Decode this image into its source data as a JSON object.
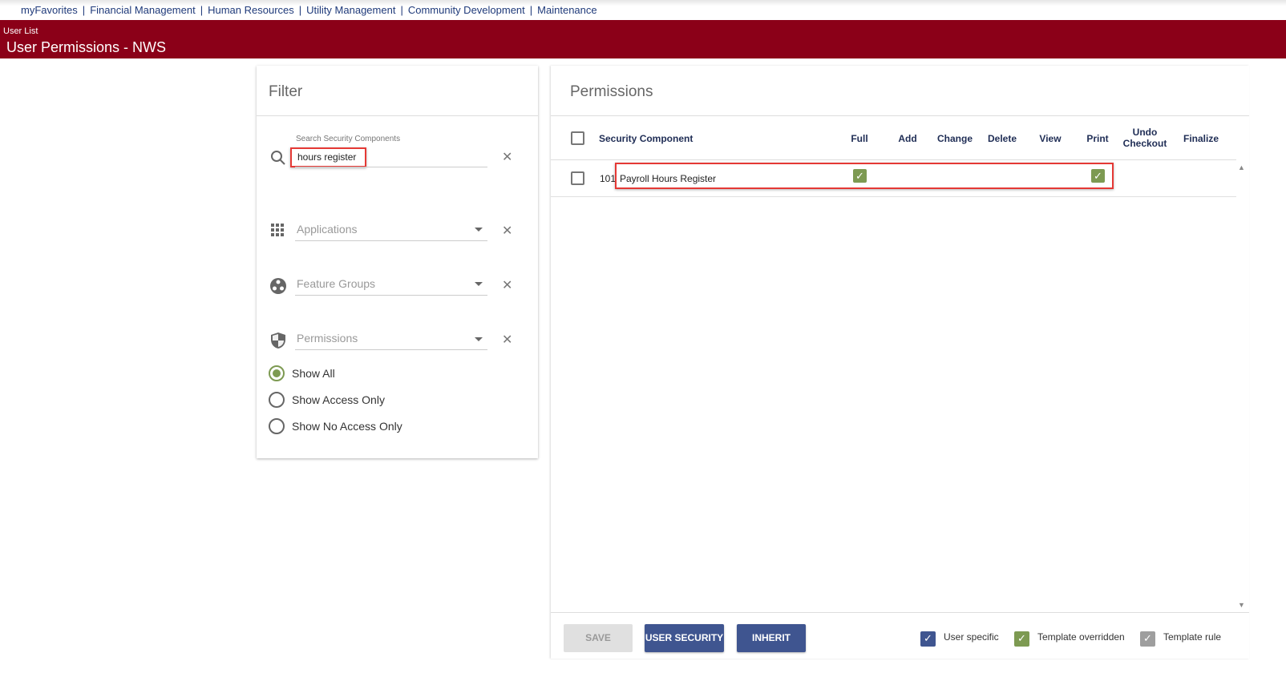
{
  "topnav": [
    "myFavorites",
    "Financial Management",
    "Human Resources",
    "Utility Management",
    "Community Development",
    "Maintenance"
  ],
  "header": {
    "breadcrumb": "User List",
    "title": "User Permissions - NWS"
  },
  "filter": {
    "title": "Filter",
    "search_label": "Search Security Components",
    "search_value": "hours register",
    "applications": "Applications",
    "feature_groups": "Feature Groups",
    "permissions": "Permissions",
    "radios": [
      "Show All",
      "Show Access Only",
      "Show No Access Only"
    ],
    "selected": "Show All"
  },
  "permissions": {
    "title": "Permissions",
    "columns": [
      "Security Component",
      "Full",
      "Add",
      "Change",
      "Delete",
      "View",
      "Print",
      "Undo Checkout",
      "Finalize"
    ],
    "rows": [
      {
        "id": "101",
        "name": "Payroll Hours Register",
        "checked": [
          "Full",
          "Print"
        ]
      }
    ]
  },
  "buttons": {
    "save": "SAVE",
    "user_security": "USER SECURITY",
    "inherit": "INHERIT"
  },
  "legend": [
    {
      "label": "User specific",
      "color": "#3f5590"
    },
    {
      "label": "Template overridden",
      "color": "#7d9a52"
    },
    {
      "label": "Template rule",
      "color": "#9e9e9e"
    }
  ]
}
